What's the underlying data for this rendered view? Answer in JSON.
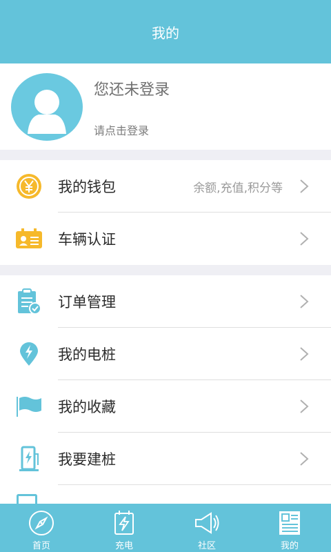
{
  "header": {
    "title": "我的"
  },
  "profile": {
    "title": "您还未登录",
    "subtitle": "请点击登录"
  },
  "menu": [
    {
      "label": "我的钱包",
      "extra": "余额,充值,积分等",
      "icon": "coin-icon"
    },
    {
      "label": "车辆认证",
      "extra": "",
      "icon": "vehicle-id-card-icon"
    },
    {
      "label": "订单管理",
      "extra": "",
      "icon": "order-clipboard-icon"
    },
    {
      "label": "我的电桩",
      "extra": "",
      "icon": "charger-pin-icon"
    },
    {
      "label": "我的收藏",
      "extra": "",
      "icon": "flag-icon"
    },
    {
      "label": "我要建桩",
      "extra": "",
      "icon": "build-charger-icon"
    }
  ],
  "tabs": [
    {
      "label": "首页",
      "icon": "compass-icon"
    },
    {
      "label": "充电",
      "icon": "charge-icon"
    },
    {
      "label": "社区",
      "icon": "megaphone-icon"
    },
    {
      "label": "我的",
      "icon": "profile-card-icon"
    }
  ],
  "colors": {
    "primary": "#63c3da",
    "separator": "#efeff4",
    "coin": "#f6b92b",
    "text": "#2b2b2b"
  }
}
